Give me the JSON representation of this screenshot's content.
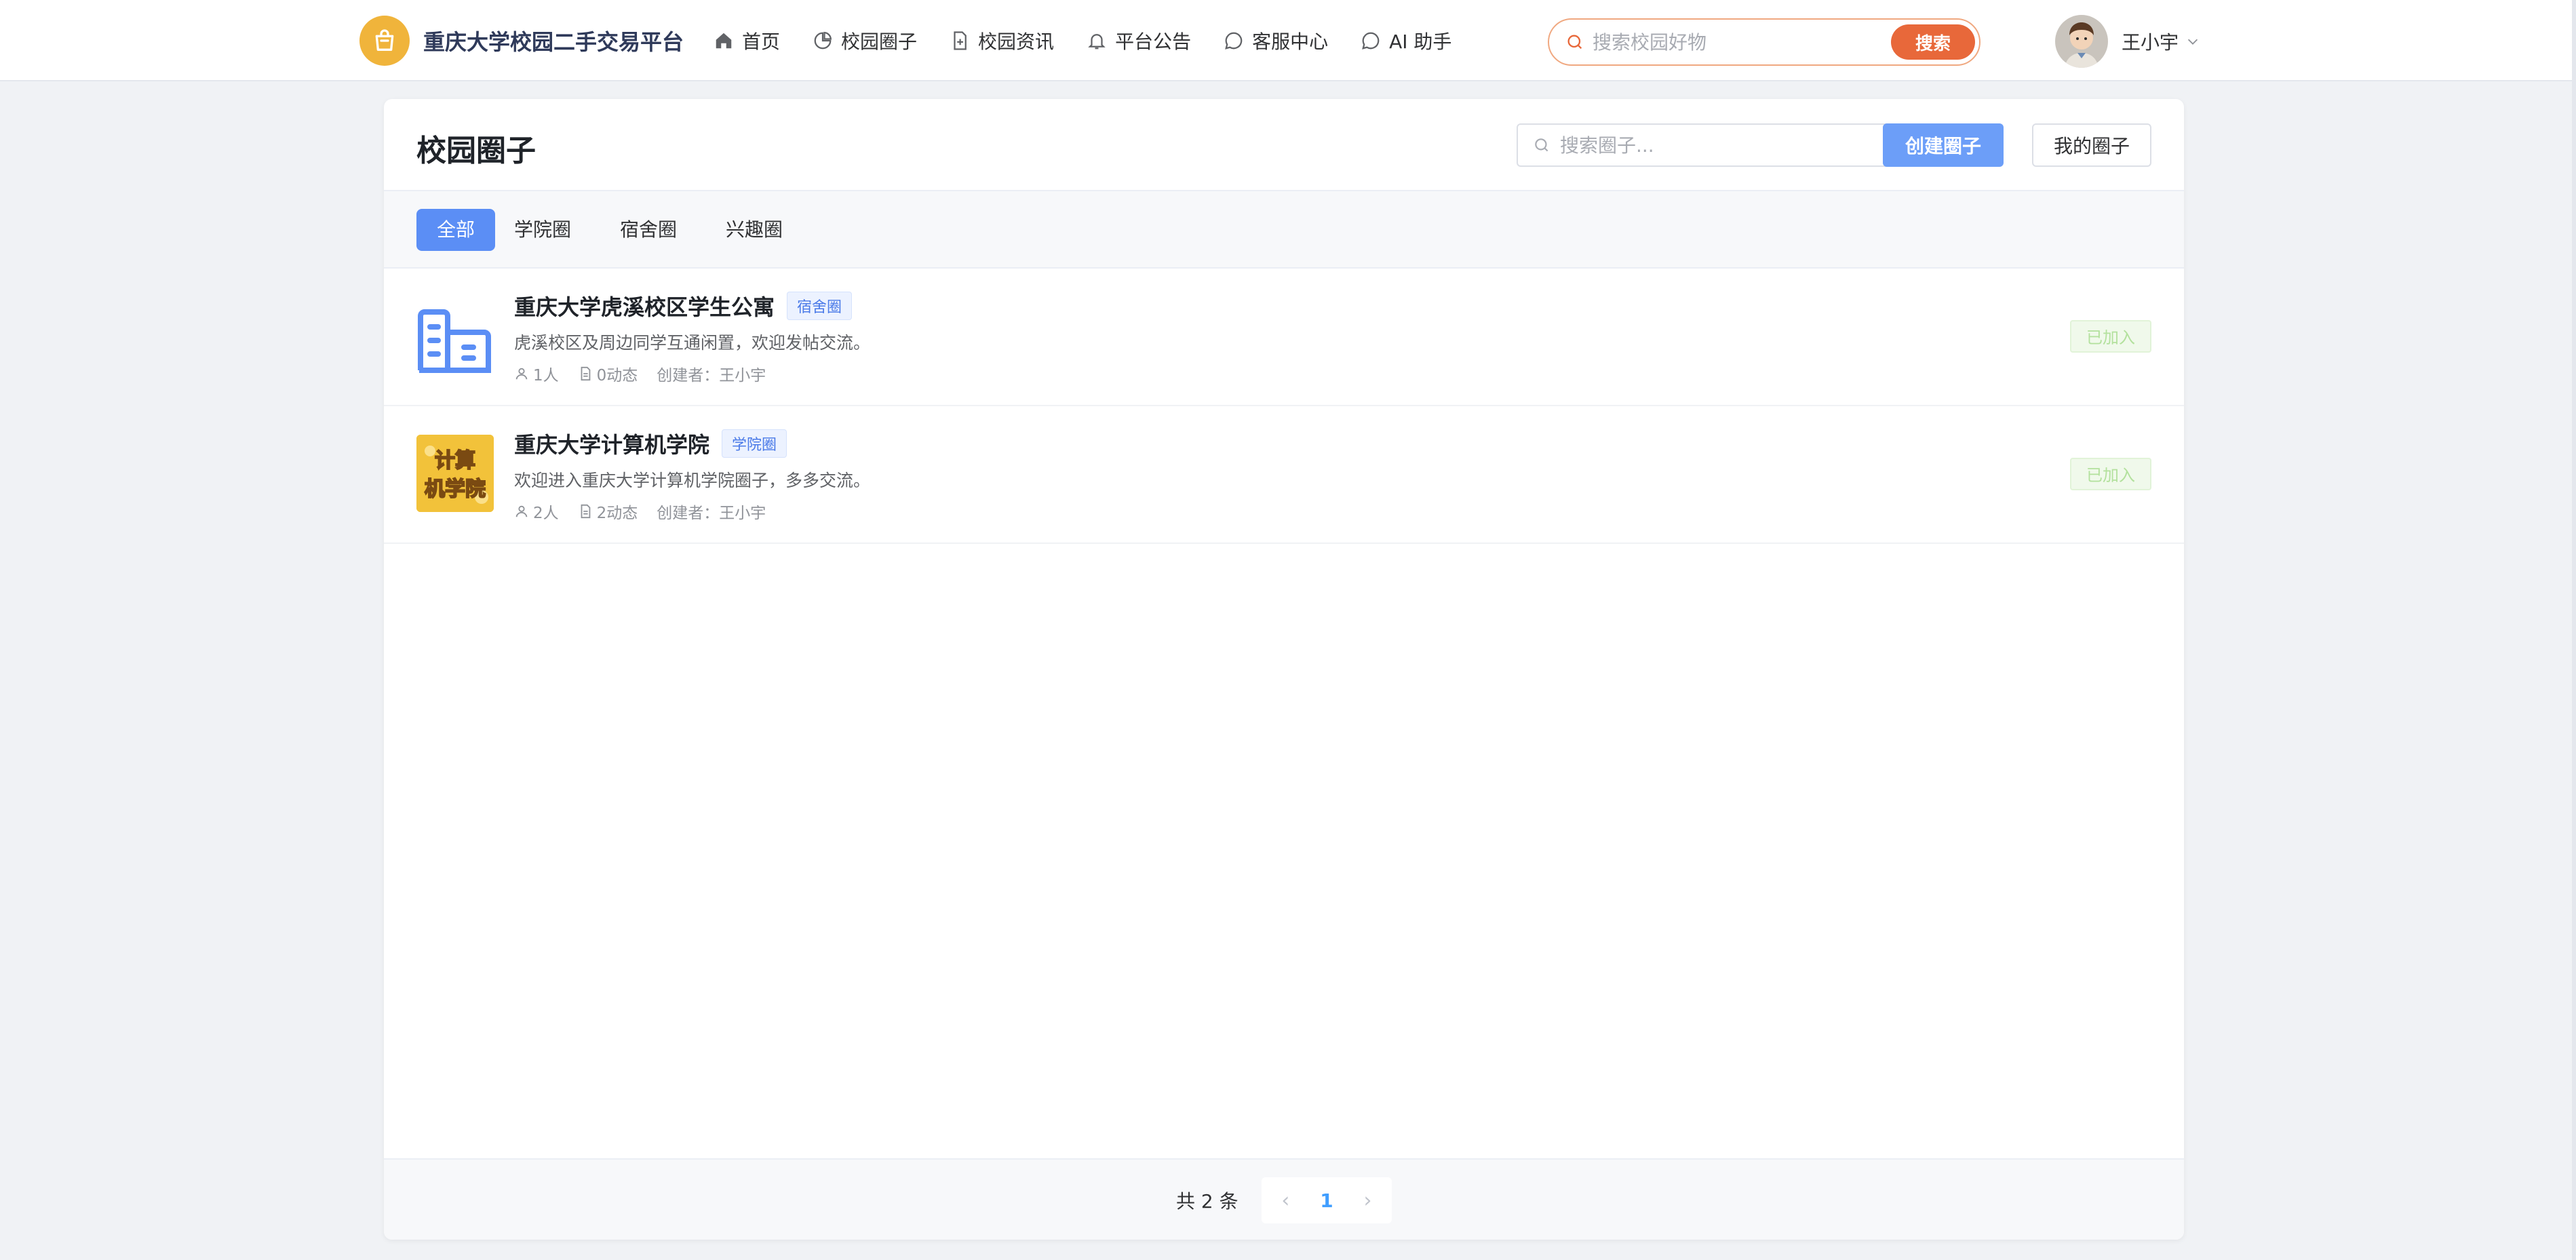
{
  "header": {
    "brand": "重庆大学校园二手交易平台",
    "nav": [
      {
        "label": "首页",
        "icon": "home-icon"
      },
      {
        "label": "校园圈子",
        "icon": "pie-chart-icon"
      },
      {
        "label": "校园资讯",
        "icon": "document-add-icon"
      },
      {
        "label": "平台公告",
        "icon": "bell-icon"
      },
      {
        "label": "客服中心",
        "icon": "chat-icon"
      },
      {
        "label": "AI 助手",
        "icon": "chat-dots-icon"
      }
    ],
    "search_placeholder": "搜索校园好物",
    "search_button": "搜索",
    "user_name": "王小宇"
  },
  "page": {
    "title": "校园圈子",
    "search_placeholder": "搜索圈子...",
    "create_button": "创建圈子",
    "mine_button": "我的圈子"
  },
  "tabs": [
    {
      "label": "全部",
      "active": true
    },
    {
      "label": "学院圈",
      "active": false
    },
    {
      "label": "宿舍圈",
      "active": false
    },
    {
      "label": "兴趣圈",
      "active": false
    }
  ],
  "circles": [
    {
      "title": "重庆大学虎溪校区学生公寓",
      "tag": "宿舍圈",
      "description": "虎溪校区及周边同学互通闲置，欢迎发帖交流。",
      "members": "1人",
      "posts": "0动态",
      "creator": "创建者：王小宇",
      "status": "已加入"
    },
    {
      "title": "重庆大学计算机学院",
      "tag": "学院圈",
      "description": "欢迎进入重庆大学计算机学院圈子，多多交流。",
      "members": "2人",
      "posts": "2动态",
      "creator": "创建者：王小宇",
      "status": "已加入",
      "thumb_text": [
        "计算",
        "机学院"
      ]
    }
  ],
  "pagination": {
    "total": "共 2 条",
    "current": "1",
    "prev": "‹",
    "next": "›"
  },
  "colors": {
    "accent": "#5b8ef5",
    "search_button": "#e8683a",
    "logo": "#f0b43b",
    "joined_text": "#b3e19d"
  }
}
